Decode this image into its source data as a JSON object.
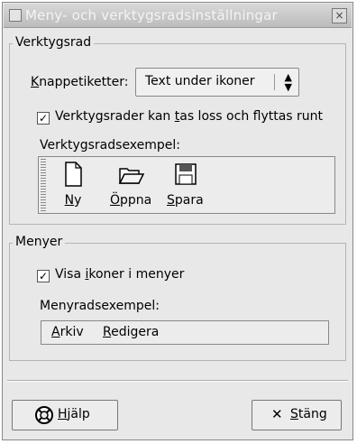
{
  "window": {
    "title": "Meny- och verktygsradsinställningar",
    "close_glyph": "×"
  },
  "toolbar_section": {
    "label": "Verktygsrad",
    "button_labels_prefix": "K",
    "button_labels_rest": "nappetiketter:",
    "button_labels_value": "Text under ikoner",
    "detachable_checked": true,
    "detachable_text_before": "Verktygsrader kan ",
    "detachable_mnemonic": "t",
    "detachable_text_after": "as loss och flyttas runt",
    "example_label": "Verktygsradsexempel:",
    "items": [
      {
        "icon": "new-document-icon",
        "mnemonic": "N",
        "rest": "y"
      },
      {
        "icon": "open-folder-icon",
        "mnemonic": "Ö",
        "rest": "ppna"
      },
      {
        "icon": "save-floppy-icon",
        "mnemonic": "S",
        "rest": "para"
      }
    ]
  },
  "menu_section": {
    "label": "Menyer",
    "show_icons_checked": true,
    "show_icons_before": "Visa ",
    "show_icons_mnemonic": "i",
    "show_icons_after": "koner i menyer",
    "example_label": "Menyradsexempel:",
    "menus": [
      {
        "mnemonic": "A",
        "rest": "rkiv"
      },
      {
        "mnemonic": "R",
        "rest": "edigera"
      }
    ]
  },
  "buttons": {
    "help_mnemonic": "H",
    "help_rest": "jälp",
    "close_mnemonic": "S",
    "close_rest": "täng",
    "close_glyph": "✕"
  },
  "check_glyph": "✓",
  "combo_arrows": "▲▼"
}
